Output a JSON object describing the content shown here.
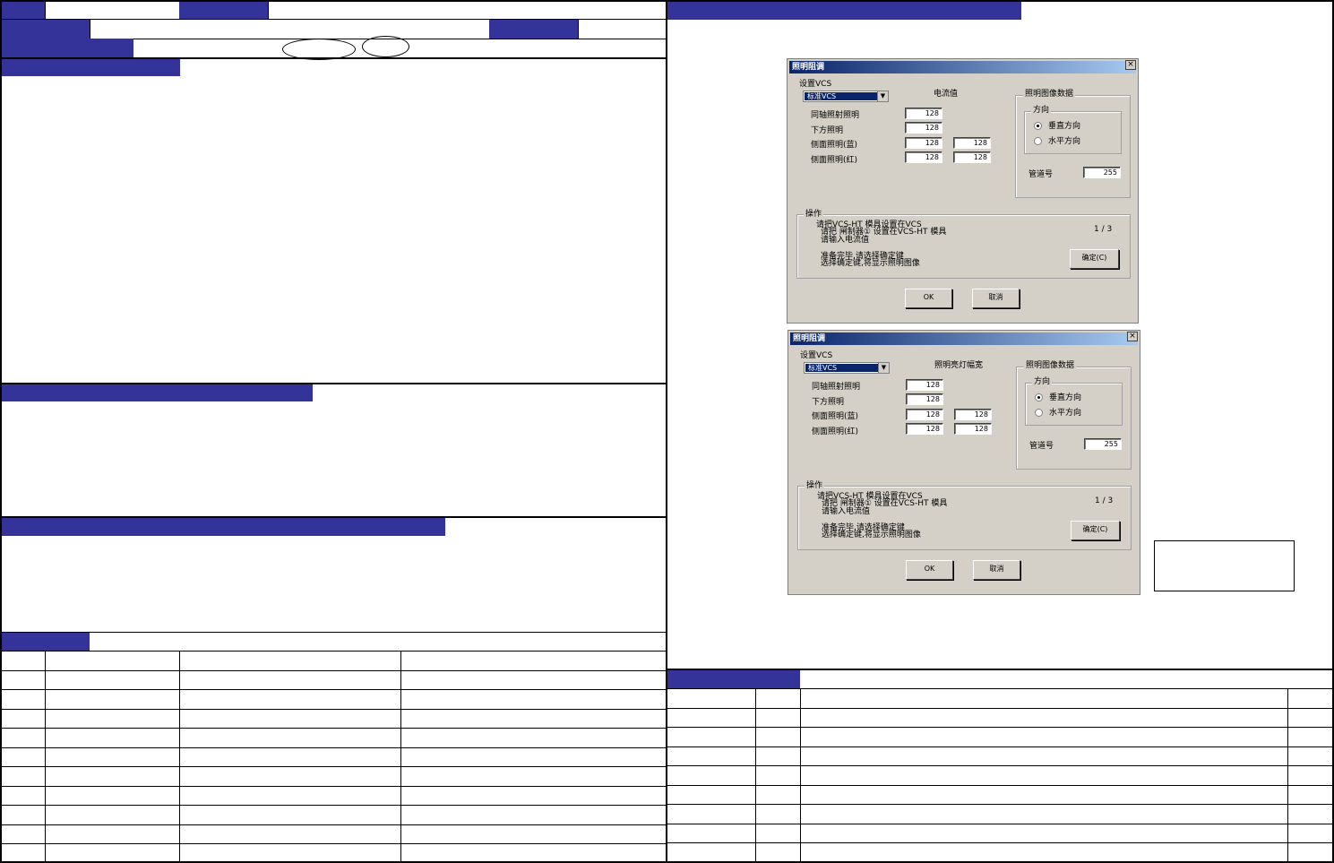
{
  "dialogs": [
    {
      "title": "照明阻调",
      "close": "×",
      "set_vcs_label": "设置VCS",
      "combo_value": "标准VCS",
      "value_header": "电流值",
      "rows": [
        {
          "label": "同轴照射照明",
          "v1": "128",
          "v2": ""
        },
        {
          "label": "下方照明",
          "v1": "128",
          "v2": ""
        },
        {
          "label": "侧面照明(蓝)",
          "v1": "128",
          "v2": "128"
        },
        {
          "label": "侧面照明(红)",
          "v1": "128",
          "v2": "128"
        }
      ],
      "image_group": "照明图像数据",
      "direction_group": "方向",
      "radio_vertical": "垂直方向",
      "radio_horizontal": "水平方向",
      "channel_label": "管道号",
      "channel_value": "255",
      "operation_group": "操作",
      "op_lines": [
        "请把VCS-HT 模具设置在VCS",
        "请把 闸制器① 设置在VCS-HT 模具",
        "请输入电流值"
      ],
      "op_lines2": [
        "准备完毕,请选择确定键",
        "选择确定键,将显示照明图像"
      ],
      "page": "1 / 3",
      "confirm_button": "确定(C)",
      "ok_button": "OK",
      "cancel_button": "取消"
    },
    {
      "title": "照明阻调",
      "close": "×",
      "set_vcs_label": "设置VCS",
      "combo_value": "标准VCS",
      "value_header": "照明亮灯幅宽",
      "rows": [
        {
          "label": "同轴照射照明",
          "v1": "128",
          "v2": ""
        },
        {
          "label": "下方照明",
          "v1": "128",
          "v2": ""
        },
        {
          "label": "侧面照明(蓝)",
          "v1": "128",
          "v2": "128"
        },
        {
          "label": "侧面照明(红)",
          "v1": "128",
          "v2": "128"
        }
      ],
      "image_group": "照明图像数据",
      "direction_group": "方向",
      "radio_vertical": "垂直方向",
      "radio_horizontal": "水平方向",
      "channel_label": "管道号",
      "channel_value": "255",
      "operation_group": "操作",
      "op_lines": [
        "请把VCS-HT 模具设置在VCS",
        "请把 闸制器① 设置在VCS-HT 模具",
        "请输入电流值"
      ],
      "op_lines2": [
        "准备完毕,请选择确定键",
        "选择确定键,将显示照明图像"
      ],
      "page": "1 / 3",
      "confirm_button": "确定(C)",
      "ok_button": "OK",
      "cancel_button": "取消"
    }
  ],
  "colors": {
    "header_fill": "#333399",
    "dialog_face": "#d4d0c8",
    "titlebar": "#0a246a"
  }
}
